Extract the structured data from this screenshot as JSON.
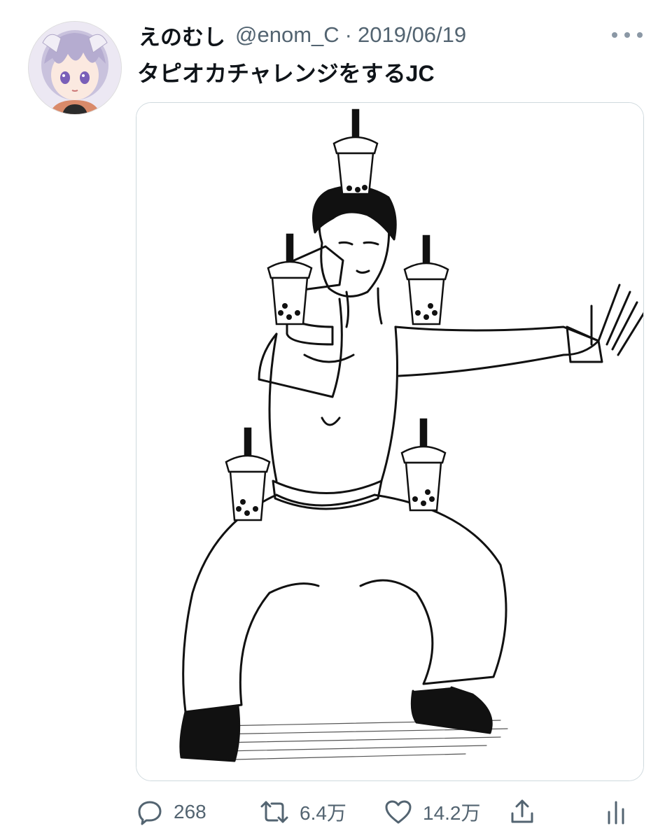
{
  "tweet": {
    "display_name": "えのむし",
    "handle": "@enom_C",
    "separator": "·",
    "date": "2019/06/19",
    "text": "タピオカチャレンジをするJC"
  },
  "icons": {
    "more": "more-horizontal-icon",
    "reply": "reply-icon",
    "retweet": "retweet-icon",
    "like": "heart-icon",
    "share": "share-icon",
    "analytics": "analytics-icon"
  },
  "actions": {
    "replies": "268",
    "retweets": "6.4万",
    "likes": "14.2万"
  },
  "colors": {
    "text_primary": "#0f1419",
    "text_secondary": "#536471",
    "border": "#cfd9de"
  }
}
